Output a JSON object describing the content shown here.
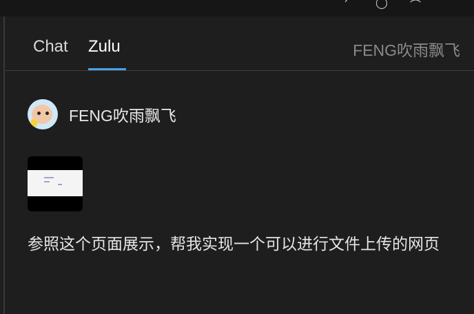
{
  "tabs": [
    {
      "label": "Chat"
    },
    {
      "label": "Zulu"
    }
  ],
  "header": {
    "user_name": "FENG吹雨飘飞"
  },
  "message": {
    "author": "FENG吹雨飘飞",
    "text": "参照这个页面展示，帮我实现一个可以进行文件上传的网页"
  },
  "icons": [
    "avatar-icon",
    "attachment-thumbnail"
  ]
}
